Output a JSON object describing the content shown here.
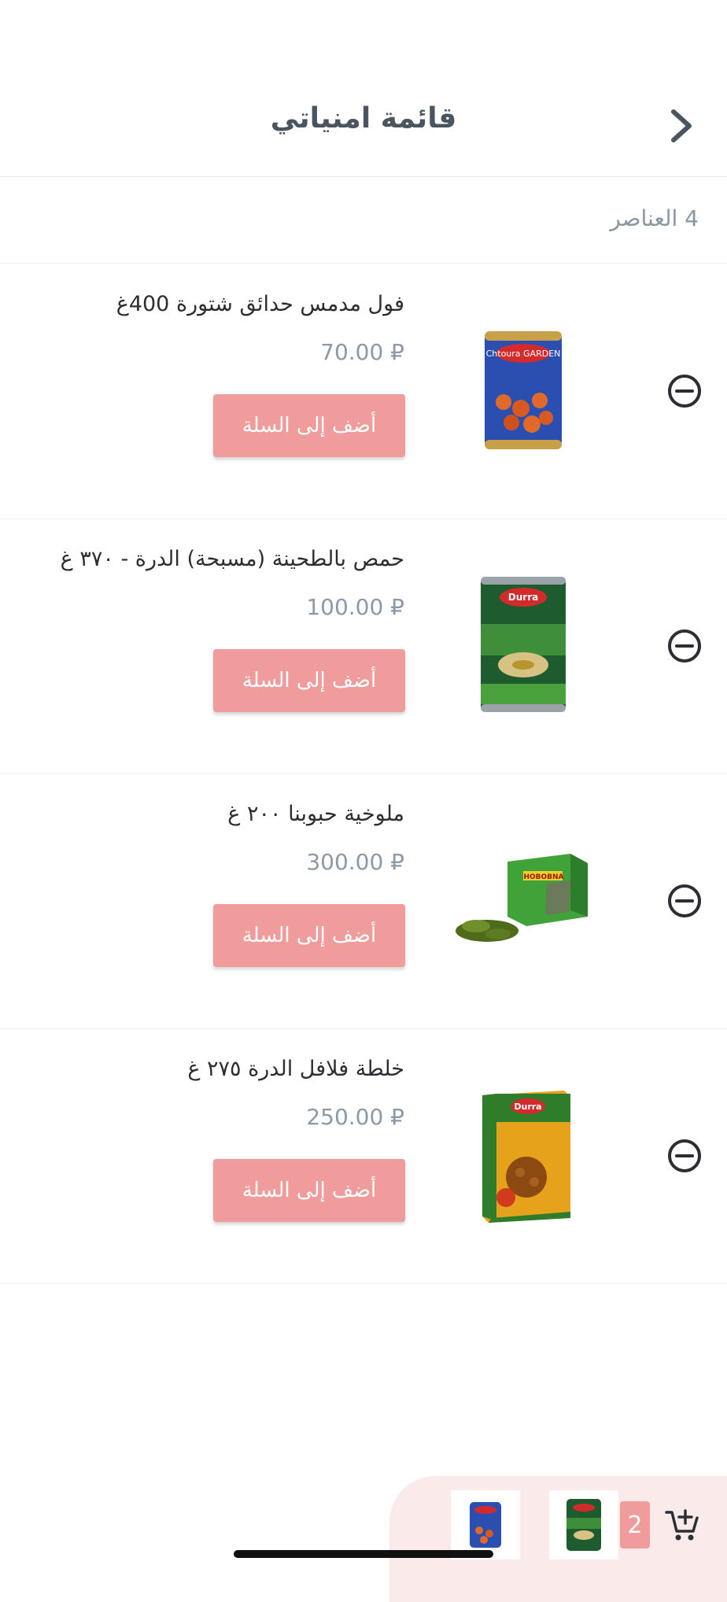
{
  "header": {
    "title": "قائمة امنياتي",
    "back_icon": "chevron-right-icon"
  },
  "summary": {
    "count_text": "4 العناصر"
  },
  "items": [
    {
      "name": "فول مدمس حدائق شتورة 400غ",
      "price": "70.00 ₽",
      "add_label": "أضف إلى السلة",
      "image_icon": "can-icon",
      "image_label": "Chtoura GARDEN"
    },
    {
      "name": "حمص بالطحينة (مسبحة) الدرة - ٣٧٠ غ",
      "price": "100.00 ₽",
      "add_label": "أضف إلى السلة",
      "image_icon": "can-icon",
      "image_label": "Durra"
    },
    {
      "name": "ملوخية حبوبنا ٢٠٠ غ",
      "price": "300.00 ₽",
      "add_label": "أضف إلى السلة",
      "image_icon": "box-icon",
      "image_label": "HOBOBNA"
    },
    {
      "name": "خلطة فلافل الدرة ٢٧٥ غ",
      "price": "250.00 ₽",
      "add_label": "أضف إلى السلة",
      "image_icon": "box-icon",
      "image_label": "Durra"
    }
  ],
  "cart": {
    "count": "2",
    "cart_icon": "add-to-cart-icon"
  },
  "colors": {
    "accent": "#f09c9c",
    "cart_bar_bg": "#fbeaea",
    "title": "#4a5560",
    "price": "#8c99a6"
  }
}
